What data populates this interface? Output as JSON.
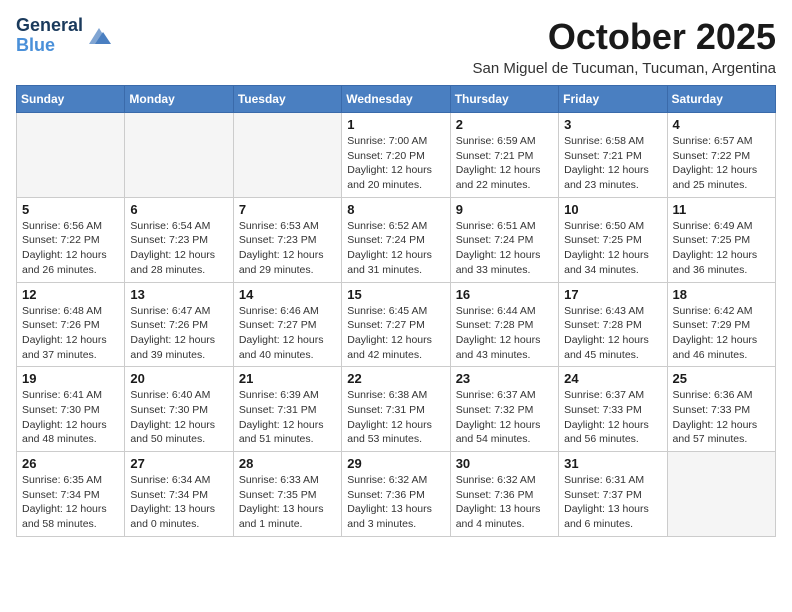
{
  "header": {
    "logo_line1": "General",
    "logo_line2": "Blue",
    "month": "October 2025",
    "location": "San Miguel de Tucuman, Tucuman, Argentina"
  },
  "days_of_week": [
    "Sunday",
    "Monday",
    "Tuesday",
    "Wednesday",
    "Thursday",
    "Friday",
    "Saturday"
  ],
  "weeks": [
    [
      {
        "day": "",
        "info": ""
      },
      {
        "day": "",
        "info": ""
      },
      {
        "day": "",
        "info": ""
      },
      {
        "day": "1",
        "info": "Sunrise: 7:00 AM\nSunset: 7:20 PM\nDaylight: 12 hours\nand 20 minutes."
      },
      {
        "day": "2",
        "info": "Sunrise: 6:59 AM\nSunset: 7:21 PM\nDaylight: 12 hours\nand 22 minutes."
      },
      {
        "day": "3",
        "info": "Sunrise: 6:58 AM\nSunset: 7:21 PM\nDaylight: 12 hours\nand 23 minutes."
      },
      {
        "day": "4",
        "info": "Sunrise: 6:57 AM\nSunset: 7:22 PM\nDaylight: 12 hours\nand 25 minutes."
      }
    ],
    [
      {
        "day": "5",
        "info": "Sunrise: 6:56 AM\nSunset: 7:22 PM\nDaylight: 12 hours\nand 26 minutes."
      },
      {
        "day": "6",
        "info": "Sunrise: 6:54 AM\nSunset: 7:23 PM\nDaylight: 12 hours\nand 28 minutes."
      },
      {
        "day": "7",
        "info": "Sunrise: 6:53 AM\nSunset: 7:23 PM\nDaylight: 12 hours\nand 29 minutes."
      },
      {
        "day": "8",
        "info": "Sunrise: 6:52 AM\nSunset: 7:24 PM\nDaylight: 12 hours\nand 31 minutes."
      },
      {
        "day": "9",
        "info": "Sunrise: 6:51 AM\nSunset: 7:24 PM\nDaylight: 12 hours\nand 33 minutes."
      },
      {
        "day": "10",
        "info": "Sunrise: 6:50 AM\nSunset: 7:25 PM\nDaylight: 12 hours\nand 34 minutes."
      },
      {
        "day": "11",
        "info": "Sunrise: 6:49 AM\nSunset: 7:25 PM\nDaylight: 12 hours\nand 36 minutes."
      }
    ],
    [
      {
        "day": "12",
        "info": "Sunrise: 6:48 AM\nSunset: 7:26 PM\nDaylight: 12 hours\nand 37 minutes."
      },
      {
        "day": "13",
        "info": "Sunrise: 6:47 AM\nSunset: 7:26 PM\nDaylight: 12 hours\nand 39 minutes."
      },
      {
        "day": "14",
        "info": "Sunrise: 6:46 AM\nSunset: 7:27 PM\nDaylight: 12 hours\nand 40 minutes."
      },
      {
        "day": "15",
        "info": "Sunrise: 6:45 AM\nSunset: 7:27 PM\nDaylight: 12 hours\nand 42 minutes."
      },
      {
        "day": "16",
        "info": "Sunrise: 6:44 AM\nSunset: 7:28 PM\nDaylight: 12 hours\nand 43 minutes."
      },
      {
        "day": "17",
        "info": "Sunrise: 6:43 AM\nSunset: 7:28 PM\nDaylight: 12 hours\nand 45 minutes."
      },
      {
        "day": "18",
        "info": "Sunrise: 6:42 AM\nSunset: 7:29 PM\nDaylight: 12 hours\nand 46 minutes."
      }
    ],
    [
      {
        "day": "19",
        "info": "Sunrise: 6:41 AM\nSunset: 7:30 PM\nDaylight: 12 hours\nand 48 minutes."
      },
      {
        "day": "20",
        "info": "Sunrise: 6:40 AM\nSunset: 7:30 PM\nDaylight: 12 hours\nand 50 minutes."
      },
      {
        "day": "21",
        "info": "Sunrise: 6:39 AM\nSunset: 7:31 PM\nDaylight: 12 hours\nand 51 minutes."
      },
      {
        "day": "22",
        "info": "Sunrise: 6:38 AM\nSunset: 7:31 PM\nDaylight: 12 hours\nand 53 minutes."
      },
      {
        "day": "23",
        "info": "Sunrise: 6:37 AM\nSunset: 7:32 PM\nDaylight: 12 hours\nand 54 minutes."
      },
      {
        "day": "24",
        "info": "Sunrise: 6:37 AM\nSunset: 7:33 PM\nDaylight: 12 hours\nand 56 minutes."
      },
      {
        "day": "25",
        "info": "Sunrise: 6:36 AM\nSunset: 7:33 PM\nDaylight: 12 hours\nand 57 minutes."
      }
    ],
    [
      {
        "day": "26",
        "info": "Sunrise: 6:35 AM\nSunset: 7:34 PM\nDaylight: 12 hours\nand 58 minutes."
      },
      {
        "day": "27",
        "info": "Sunrise: 6:34 AM\nSunset: 7:34 PM\nDaylight: 13 hours\nand 0 minutes."
      },
      {
        "day": "28",
        "info": "Sunrise: 6:33 AM\nSunset: 7:35 PM\nDaylight: 13 hours\nand 1 minute."
      },
      {
        "day": "29",
        "info": "Sunrise: 6:32 AM\nSunset: 7:36 PM\nDaylight: 13 hours\nand 3 minutes."
      },
      {
        "day": "30",
        "info": "Sunrise: 6:32 AM\nSunset: 7:36 PM\nDaylight: 13 hours\nand 4 minutes."
      },
      {
        "day": "31",
        "info": "Sunrise: 6:31 AM\nSunset: 7:37 PM\nDaylight: 13 hours\nand 6 minutes."
      },
      {
        "day": "",
        "info": ""
      }
    ]
  ]
}
